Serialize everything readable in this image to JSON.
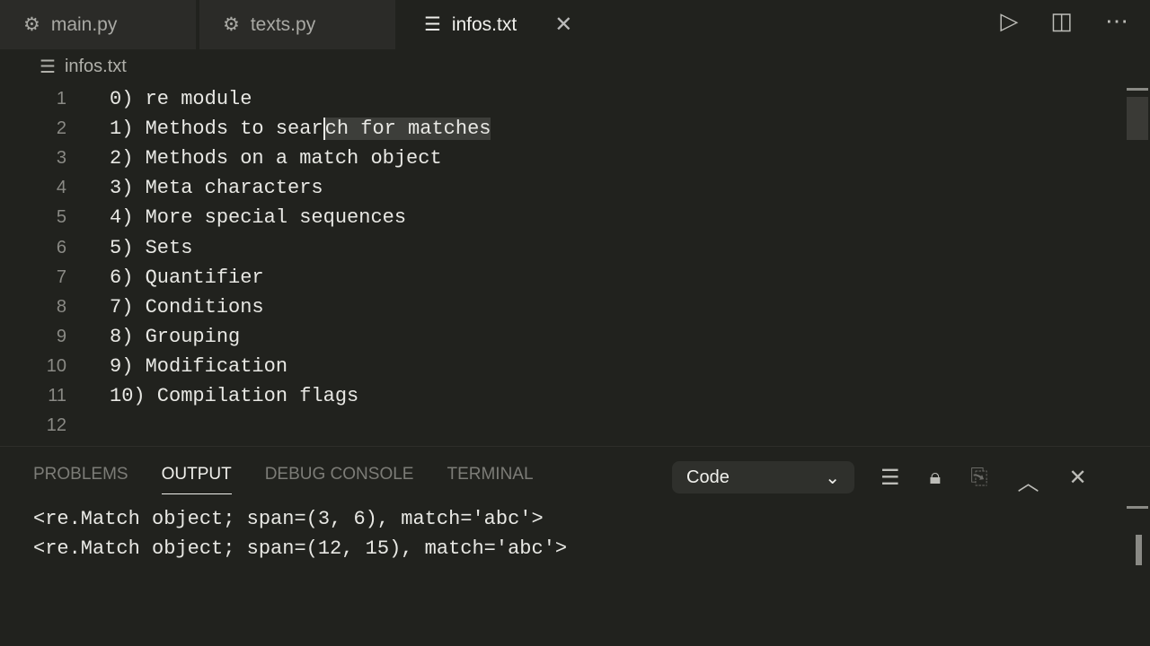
{
  "tabs": [
    {
      "label": "main.py",
      "icon": "python-icon"
    },
    {
      "label": "texts.py",
      "icon": "python-icon"
    },
    {
      "label": "infos.txt",
      "icon": "text-file-icon",
      "active": true
    }
  ],
  "breadcrumb": "infos.txt",
  "editor": {
    "lines": [
      {
        "n": "1",
        "text": "0) re module"
      },
      {
        "n": "2",
        "before": "1) Methods to sear",
        "selected": "ch for matches"
      },
      {
        "n": "3",
        "text": "2) Methods on a match object"
      },
      {
        "n": "4",
        "text": "3) Meta characters"
      },
      {
        "n": "5",
        "text": "4) More special sequences"
      },
      {
        "n": "6",
        "text": "5) Sets"
      },
      {
        "n": "7",
        "text": "6) Quantifier"
      },
      {
        "n": "8",
        "text": "7) Conditions"
      },
      {
        "n": "9",
        "text": "8) Grouping"
      },
      {
        "n": "10",
        "text": "9) Modification"
      },
      {
        "n": "11",
        "text": "10) Compilation flags"
      },
      {
        "n": "12",
        "text": ""
      }
    ]
  },
  "panel": {
    "tabs": [
      "PROBLEMS",
      "OUTPUT",
      "DEBUG CONSOLE",
      "TERMINAL"
    ],
    "active": "OUTPUT",
    "channel": "Code",
    "output": [
      "<re.Match object; span=(3, 6), match='abc'>",
      "<re.Match object; span=(12, 15), match='abc'>"
    ]
  }
}
